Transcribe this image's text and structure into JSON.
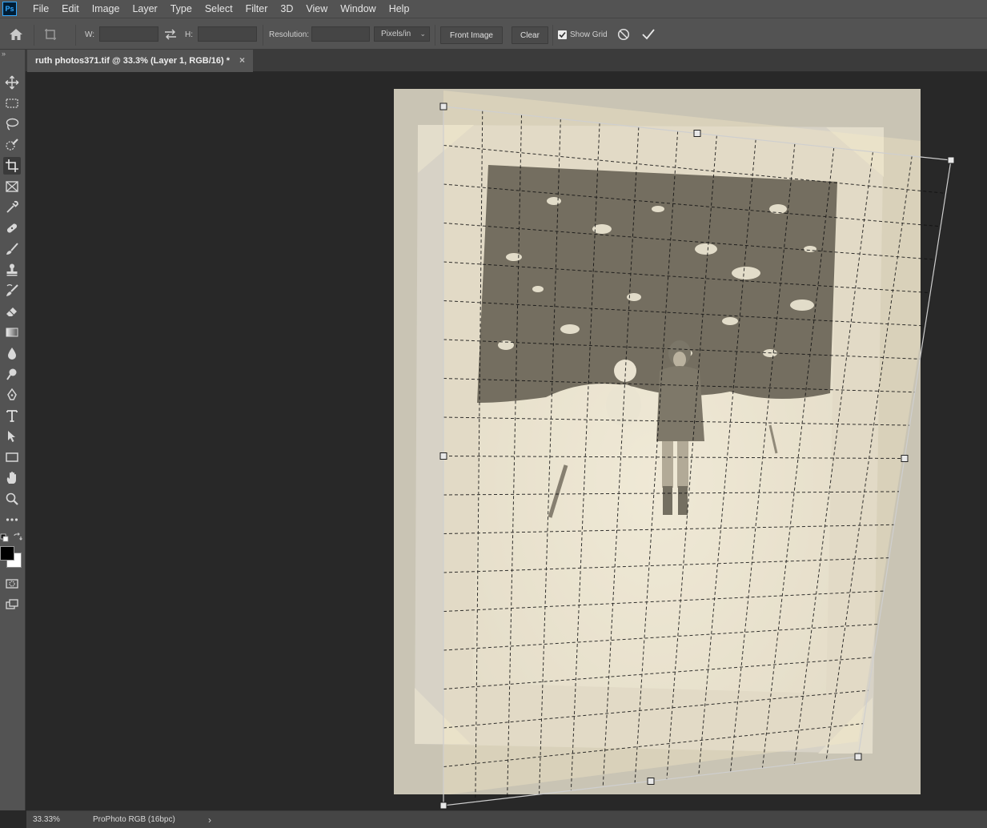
{
  "app": {
    "logo": "Ps"
  },
  "menu": [
    "File",
    "Edit",
    "Image",
    "Layer",
    "Type",
    "Select",
    "Filter",
    "3D",
    "View",
    "Window",
    "Help"
  ],
  "options": {
    "w_label": "W:",
    "w_value": "",
    "h_label": "H:",
    "h_value": "",
    "resolution_label": "Resolution:",
    "resolution_value": "",
    "units": "Pixels/in",
    "front_image_label": "Front Image",
    "clear_label": "Clear",
    "show_grid_label": "Show Grid",
    "show_grid_checked": true
  },
  "document": {
    "tab_title": "ruth photos371.tif @ 33.3% (Layer 1, RGB/16) *",
    "close_glyph": "×"
  },
  "status": {
    "zoom": "33.33%",
    "profile": "ProPhoto RGB (16bpc)",
    "arrow": "›"
  },
  "icons": {
    "home": "home-icon",
    "crop": "perspective-crop-icon",
    "swap": "swap-icon",
    "cancel": "cancel-icon",
    "commit": "checkmark-icon"
  },
  "colors": {
    "chrome": "#535353",
    "canvas": "#282828",
    "foreground": "#000000",
    "background": "#ffffff"
  }
}
